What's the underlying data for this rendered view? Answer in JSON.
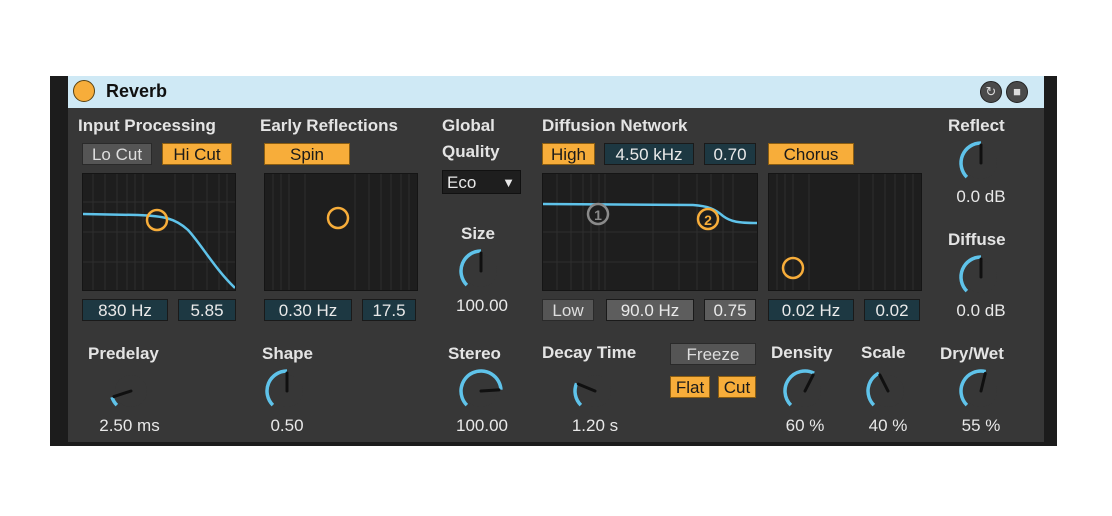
{
  "device": {
    "title": "Reverb",
    "colors": {
      "accent": "#f7ad3a",
      "arc": "#5fc3ea",
      "titlebar": "#cfe9f5",
      "panel": "#373737"
    }
  },
  "header_icons": {
    "hotswap": "hotswap-icon",
    "save": "save-preset-icon"
  },
  "input_processing": {
    "label": "Input Processing",
    "lo_cut": "Lo Cut",
    "hi_cut": "Hi Cut",
    "freq": "830 Hz",
    "q": "5.85",
    "lo_cut_on": false,
    "hi_cut_on": true
  },
  "predelay": {
    "label": "Predelay",
    "value": "2.50 ms",
    "level": 0.1
  },
  "early_reflections": {
    "label": "Early Reflections",
    "spin": "Spin",
    "spin_on": true,
    "rate": "0.30 Hz",
    "amount": "17.5"
  },
  "shape": {
    "label": "Shape",
    "value": "0.50",
    "level": 0.5
  },
  "global": {
    "label": "Global",
    "quality_label": "Quality",
    "quality_value": "Eco",
    "size_label": "Size",
    "size_value": "100.00",
    "size_level": 0.5,
    "stereo_label": "Stereo",
    "stereo_value": "100.00",
    "stereo_level": 0.82
  },
  "diffusion": {
    "label": "Diffusion Network",
    "high": "High",
    "high_on": true,
    "high_freq": "4.50 kHz",
    "high_q": "0.70",
    "low": "Low",
    "low_on": false,
    "low_freq": "90.0 Hz",
    "low_q": "0.75",
    "chorus": "Chorus",
    "chorus_on": true,
    "chorus_rate": "0.02 Hz",
    "chorus_amount": "0.02",
    "marker_1": "1",
    "marker_2": "2"
  },
  "decay_time": {
    "label": "Decay Time",
    "value": "1.20 s",
    "level": 0.25
  },
  "freeze": {
    "label": "Freeze",
    "flat": "Flat",
    "cut": "Cut",
    "flat_on": true,
    "cut_on": true
  },
  "density": {
    "label": "Density",
    "value": "60 %",
    "level": 0.6
  },
  "scale": {
    "label": "Scale",
    "value": "40 %",
    "level": 0.4
  },
  "reflect": {
    "label": "Reflect",
    "value": "0.0 dB",
    "level": 0.5
  },
  "diffuse": {
    "label": "Diffuse",
    "value": "0.0 dB",
    "level": 0.5
  },
  "dry_wet": {
    "label": "Dry/Wet",
    "value": "55 %",
    "level": 0.55
  }
}
